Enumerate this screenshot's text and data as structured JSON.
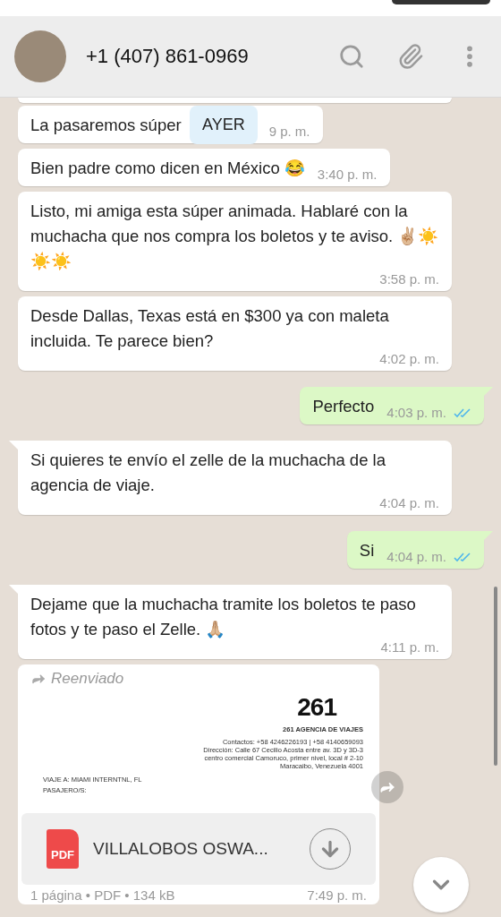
{
  "header": {
    "contact": "+1 (407) 861-0969"
  },
  "date_badge": "AYER",
  "messages": [
    {
      "kind": "text",
      "outgoing": false,
      "tail": false,
      "text": "La pasaremos súper",
      "time": "9 p. m.",
      "covered": true
    },
    {
      "kind": "text",
      "outgoing": false,
      "tail": false,
      "text": "Bien padre como dicen en México 😂",
      "time": "3:40 p. m."
    },
    {
      "kind": "text",
      "outgoing": false,
      "tail": false,
      "text": "Listo, mi amiga esta súper animada. Hablaré con la muchacha que nos compra los boletos y te aviso. ✌🏼☀️☀️☀️",
      "time": "3:58 p. m."
    },
    {
      "kind": "text",
      "outgoing": false,
      "tail": false,
      "text": "Desde Dallas, Texas está en $300 ya con maleta incluida. Te parece bien?",
      "time": "4:02 p. m."
    },
    {
      "kind": "text",
      "outgoing": true,
      "tail": true,
      "text": "Perfecto",
      "time": "4:03 p. m.",
      "read": true
    },
    {
      "kind": "text",
      "outgoing": false,
      "tail": true,
      "text": "Si quieres te envío el zelle de la muchacha de la agencia de viaje.",
      "time": "4:04 p. m."
    },
    {
      "kind": "text",
      "outgoing": true,
      "tail": true,
      "text": "Si",
      "time": "4:04 p. m.",
      "read": true
    },
    {
      "kind": "text",
      "outgoing": false,
      "tail": true,
      "text": "Dejame que la muchacha tramite los boletos te paso fotos y te paso el Zelle. 🙏🏼",
      "time": "4:11 p. m."
    },
    {
      "kind": "document",
      "outgoing": false,
      "forwarded": "Reenviado",
      "preview": {
        "logo": "261",
        "agency": "261 AGENCIA DE VIAJES",
        "contact": "Contactos: +58 4246226193 | +58 4140659093",
        "address": [
          "Dirección: Calle 67 Cecilio Acosta entre av. 3D y 3D-3",
          "centro comercial Camoruco, primer nivel, local # 2-10",
          "Maracaibo, Venezuela 4001"
        ],
        "trip": "VIAJE A: MIAMI INTERNTNL, FL",
        "passengers": "PASAJERO/S:"
      },
      "file_type": "PDF",
      "file_name": "VILLALOBOS OSWA...",
      "meta": "1 página • PDF • 134 kB",
      "time": "7:49 p. m."
    }
  ]
}
